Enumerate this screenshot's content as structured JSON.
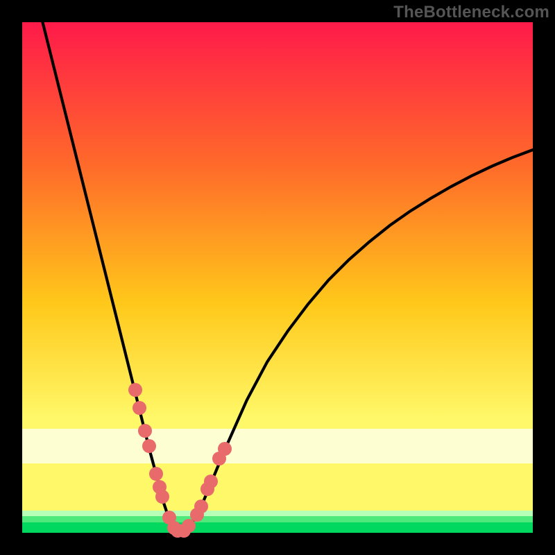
{
  "attribution": "TheBottleneck.com",
  "colors": {
    "bg": "#000000",
    "grad_top": "#ff1a4a",
    "grad_mid_upper": "#ff6a2a",
    "grad_mid": "#ffc81a",
    "grad_lower": "#fff96a",
    "grad_pale": "#fdffd2",
    "grad_green_light": "#b8ffb8",
    "grad_green_mid": "#4fe87a",
    "grad_green": "#00d860",
    "curve": "#000000",
    "dot": "#e86a6a"
  },
  "chart_data": {
    "type": "line",
    "title": "",
    "xlabel": "",
    "ylabel": "",
    "xlim": [
      0,
      100
    ],
    "ylim": [
      0,
      100
    ],
    "grid": false,
    "legend": false,
    "series": [
      {
        "name": "left-branch",
        "x": [
          4,
          6,
          8,
          10,
          12,
          14,
          16,
          18,
          20,
          22,
          23.5,
          25,
          26.5,
          27.5,
          28.5,
          29.5,
          30.5
        ],
        "y": [
          100,
          92,
          84,
          76,
          68,
          60,
          52,
          44,
          36,
          28,
          22,
          16,
          10.5,
          6.5,
          3.5,
          1.4,
          0.3
        ]
      },
      {
        "name": "right-branch",
        "x": [
          31.5,
          33,
          35,
          37.5,
          40,
          44,
          48,
          52,
          56,
          60,
          64,
          68,
          72,
          76,
          80,
          84,
          88,
          92,
          96,
          100
        ],
        "y": [
          0.3,
          1.5,
          5,
          11,
          17,
          26,
          33.5,
          39.5,
          44.8,
          49.5,
          53.5,
          57,
          60.2,
          63,
          65.5,
          67.8,
          69.9,
          71.8,
          73.5,
          75
        ]
      }
    ],
    "dots": {
      "name": "highlighted-points",
      "x": [
        22.2,
        23.0,
        24.0,
        24.8,
        26.2,
        26.9,
        27.4,
        28.8,
        29.7,
        30.4,
        31.6,
        32.6,
        34.2,
        35.0,
        36.3,
        36.9,
        38.6,
        39.7
      ],
      "y": [
        28.0,
        24.5,
        20.0,
        17.0,
        11.5,
        9.0,
        7.0,
        3.0,
        1.0,
        0.4,
        0.4,
        1.3,
        3.5,
        5.2,
        8.5,
        10.0,
        14.5,
        16.5
      ]
    },
    "bands": [
      {
        "name": "pale-yellow",
        "y0": 13.6,
        "y1": 20.4,
        "color": "#fdffd2"
      },
      {
        "name": "light-green",
        "y0": 3.2,
        "y1": 4.3,
        "color": "#b8ffb8"
      },
      {
        "name": "mid-green",
        "y0": 2.1,
        "y1": 3.2,
        "color": "#4fe87a"
      },
      {
        "name": "green",
        "y0": 0,
        "y1": 2.1,
        "color": "#00d860"
      }
    ]
  }
}
